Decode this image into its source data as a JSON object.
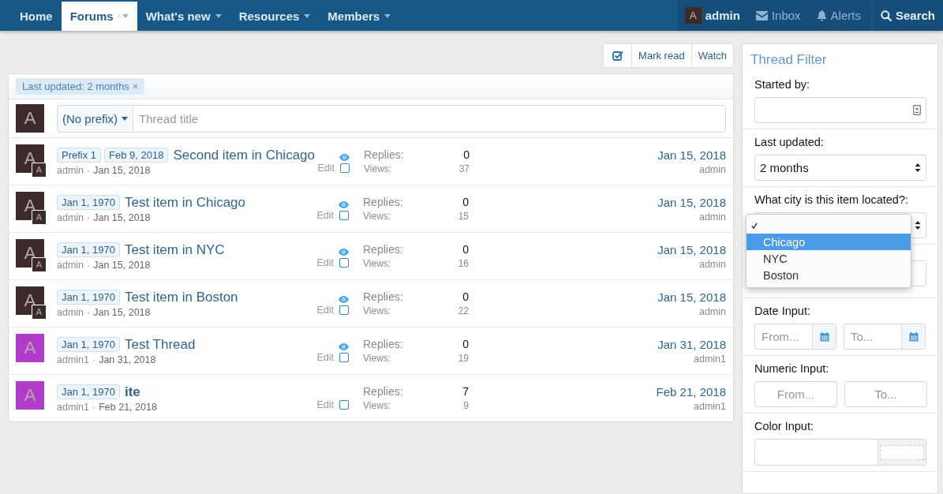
{
  "nav": {
    "tabs": [
      {
        "label": "Home",
        "selected": false,
        "has_menu": false
      },
      {
        "label": "Forums",
        "selected": true,
        "has_menu": true
      },
      {
        "label": "What's new",
        "selected": false,
        "has_menu": true
      },
      {
        "label": "Resources",
        "selected": false,
        "has_menu": true
      },
      {
        "label": "Members",
        "selected": false,
        "has_menu": true
      }
    ],
    "user": {
      "avatar": "A",
      "name": "admin"
    },
    "links": [
      {
        "kind": "inbox",
        "label": "Inbox"
      },
      {
        "kind": "alerts",
        "label": "Alerts"
      },
      {
        "kind": "search",
        "label": "Search"
      }
    ]
  },
  "toolbar": [
    {
      "kind": "select"
    },
    {
      "kind": "text",
      "label": "Mark read"
    },
    {
      "kind": "text",
      "label": "Watch"
    }
  ],
  "active_filter": "Last updated: 2 months",
  "new_thread": {
    "avatar": "A",
    "prefix": "(No prefix)",
    "placeholder": "Thread title"
  },
  "threads": [
    {
      "avatar": "A",
      "color": "#3d2b2b",
      "second_avatar": "A",
      "prefixes": [
        "Prefix 1",
        "Feb 9, 2018"
      ],
      "title": "Second item in Chicago",
      "unread": false,
      "author": "admin",
      "separator": "·",
      "date": "Jan 15, 2018",
      "watched": true,
      "edit": "Edit",
      "checked": false,
      "replies_label": "Replies:",
      "replies": "0",
      "views_label": "Views:",
      "views": "37",
      "last_date": "Jan 15, 2018",
      "last_user": "admin"
    },
    {
      "avatar": "A",
      "color": "#3d2b2b",
      "second_avatar": "A",
      "prefixes": [
        "Jan 1, 1970"
      ],
      "title": "Test item in Chicago",
      "unread": false,
      "author": "admin",
      "separator": "·",
      "date": "Jan 15, 2018",
      "watched": true,
      "edit": "Edit",
      "checked": false,
      "replies_label": "Replies:",
      "replies": "0",
      "views_label": "Views:",
      "views": "15",
      "last_date": "Jan 15, 2018",
      "last_user": "admin"
    },
    {
      "avatar": "A",
      "color": "#3d2b2b",
      "second_avatar": "A",
      "prefixes": [
        "Jan 1, 1970"
      ],
      "title": "Test item in NYC",
      "unread": false,
      "author": "admin",
      "separator": "·",
      "date": "Jan 15, 2018",
      "watched": true,
      "edit": "Edit",
      "checked": false,
      "replies_label": "Replies:",
      "replies": "0",
      "views_label": "Views:",
      "views": "16",
      "last_date": "Jan 15, 2018",
      "last_user": "admin"
    },
    {
      "avatar": "A",
      "color": "#3d2b2b",
      "second_avatar": "A",
      "prefixes": [
        "Jan 1, 1970"
      ],
      "title": "Test item in Boston",
      "unread": false,
      "author": "admin",
      "separator": "·",
      "date": "Jan 15, 2018",
      "watched": true,
      "edit": "Edit",
      "checked": false,
      "replies_label": "Replies:",
      "replies": "0",
      "views_label": "Views:",
      "views": "22",
      "last_date": "Jan 15, 2018",
      "last_user": "admin"
    },
    {
      "avatar": "A",
      "color": "#b13ccb",
      "prefixes": [
        "Jan 1, 1970"
      ],
      "title": "Test Thread",
      "unread": false,
      "author": "admin1",
      "separator": "·",
      "date": "Jan 31, 2018",
      "watched": true,
      "edit": "Edit",
      "checked": false,
      "replies_label": "Replies:",
      "replies": "0",
      "views_label": "Views:",
      "views": "19",
      "last_date": "Jan 31, 2018",
      "last_user": "admin1"
    },
    {
      "avatar": "A",
      "color": "#b13ccb",
      "prefixes": [
        "Jan 1, 1970"
      ],
      "title": "ite",
      "unread": true,
      "author": "admin1",
      "separator": "·",
      "date": "Feb 21, 2018",
      "watched": false,
      "edit": "Edit",
      "checked": false,
      "replies_label": "Replies:",
      "replies": "7",
      "views_label": "Views:",
      "views": "9",
      "last_date": "Feb 21, 2018",
      "last_user": "admin1"
    }
  ],
  "filter": {
    "title": "Thread Filter",
    "fields": [
      {
        "kind": "user",
        "label": "Started by:"
      },
      {
        "kind": "select",
        "label": "Last updated:",
        "value": "2 months"
      },
      {
        "kind": "select",
        "label": "What city is this item located?:",
        "open": true,
        "options": [
          {
            "selected": true,
            "highlighted": false
          },
          {
            "label": "Chicago",
            "selected": false,
            "highlighted": true
          },
          {
            "label": "NYC",
            "selected": false,
            "highlighted": false
          },
          {
            "label": "Boston",
            "selected": false,
            "highlighted": false
          }
        ]
      },
      {
        "kind": "text"
      },
      {
        "kind": "date_range",
        "label": "Date Input:",
        "inputs": [
          {
            "placeholder": "From..."
          },
          {
            "placeholder": "To..."
          }
        ]
      },
      {
        "kind": "number_range",
        "label": "Numeric Input:",
        "inputs": [
          {
            "placeholder": "From..."
          },
          {
            "placeholder": "To..."
          }
        ]
      },
      {
        "kind": "color",
        "label": "Color Input:"
      }
    ]
  }
}
